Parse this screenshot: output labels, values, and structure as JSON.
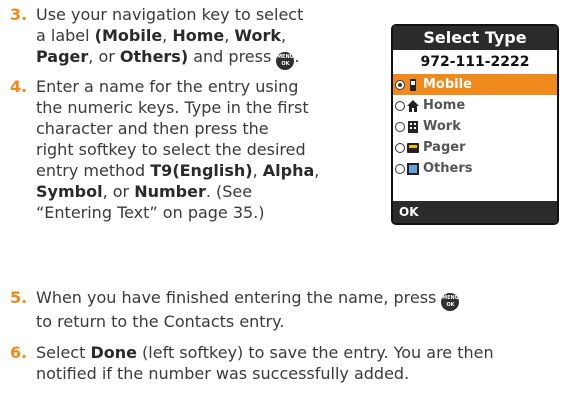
{
  "steps": [
    {
      "num": "3.",
      "lines": [
        [
          "Use your navigation key to select"
        ],
        [
          "a label "
        ],
        [
          "",
          " and press "
        ]
      ],
      "parts": {
        "l2_open": "(Mobile",
        "l2_c1": ", ",
        "l2_home": "Home",
        "l2_c2": ", ",
        "l2_work": "Work",
        "l2_c3": ",",
        "l3_pager": "Pager",
        "l3_or": ", or ",
        "l3_others": "Others)",
        "l3_press": " and press ",
        "l3_end": "."
      }
    },
    {
      "num": "4.",
      "line1": "Enter a name for the entry using",
      "line2": "the numeric keys. Type in the first",
      "line3": "character and then press the",
      "line4": "right softkey to select the desired",
      "line5_a": "entry method ",
      "line5_b": "T9(English)",
      "line5_c": ", ",
      "line5_d": "Alpha",
      "line5_e": ",",
      "line6_a": "Symbol",
      "line6_b": ", or ",
      "line6_c": "Number",
      "line6_d": ". (See",
      "line7": "“Entering Text” on page 35.)"
    },
    {
      "num": "5.",
      "line1_a": "When you have finished entering the name, press ",
      "line2": "to return to the Contacts entry."
    },
    {
      "num": "6.",
      "line1_a": "Select ",
      "line1_b": "Done",
      "line1_c": " (left softkey) to save the entry. You are then",
      "line2": "notified if the number was successfully added."
    }
  ],
  "menu_button": {
    "top": "MENU",
    "bottom": "OK"
  },
  "phone": {
    "title": "Select Type",
    "number": "972-111-2222",
    "options": [
      {
        "label": "Mobile",
        "icon": "mobile-phone-icon",
        "selected": true
      },
      {
        "label": "Home",
        "icon": "house-icon",
        "selected": false
      },
      {
        "label": "Work",
        "icon": "building-icon",
        "selected": false
      },
      {
        "label": "Pager",
        "icon": "pager-icon",
        "selected": false
      },
      {
        "label": "Others",
        "icon": "contact-card-icon",
        "selected": false
      }
    ],
    "softkey": "OK"
  },
  "colors": {
    "accent": "#f08a1c",
    "header": "#2b2b2b",
    "text": "#3a3a3a"
  }
}
